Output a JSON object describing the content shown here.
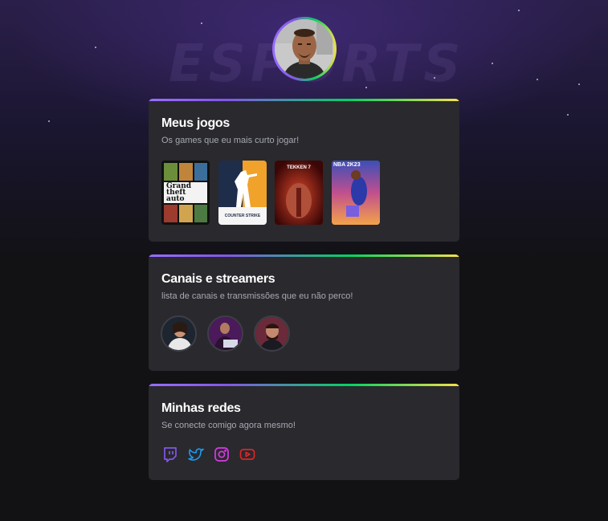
{
  "profile": {
    "avatar": "profile-photo"
  },
  "background": {
    "logo_text": "ESPORTS"
  },
  "games_card": {
    "title": "Meus jogos",
    "subtitle": "Os games que eu mais curto jogar!",
    "games": [
      {
        "name": "Grand Theft Auto V",
        "cover_text_1": "Grand",
        "cover_text_2": "theft",
        "cover_text_3": "auto"
      },
      {
        "name": "Counter-Strike",
        "cover_text_1": "COUNTER STRIKE"
      },
      {
        "name": "Tekken 7",
        "cover_text_1": "TEKKEN 7"
      },
      {
        "name": "NBA 2K23",
        "cover_text_1": "NBA 2K23"
      }
    ]
  },
  "channels_card": {
    "title": "Canais e streamers",
    "subtitle": "lista de canais e transmissões que eu não perco!",
    "streamers": [
      "streamer-1",
      "streamer-2",
      "streamer-3"
    ]
  },
  "social_card": {
    "title": "Minhas redes",
    "subtitle": "Se conecte comigo agora mesmo!",
    "links": [
      {
        "name": "twitch-icon",
        "color": "#8257e6"
      },
      {
        "name": "twitter-icon",
        "color": "#1d9bf0"
      },
      {
        "name": "instagram-icon",
        "color": "#d73ae4"
      },
      {
        "name": "youtube-icon",
        "color": "#e02424"
      }
    ]
  }
}
